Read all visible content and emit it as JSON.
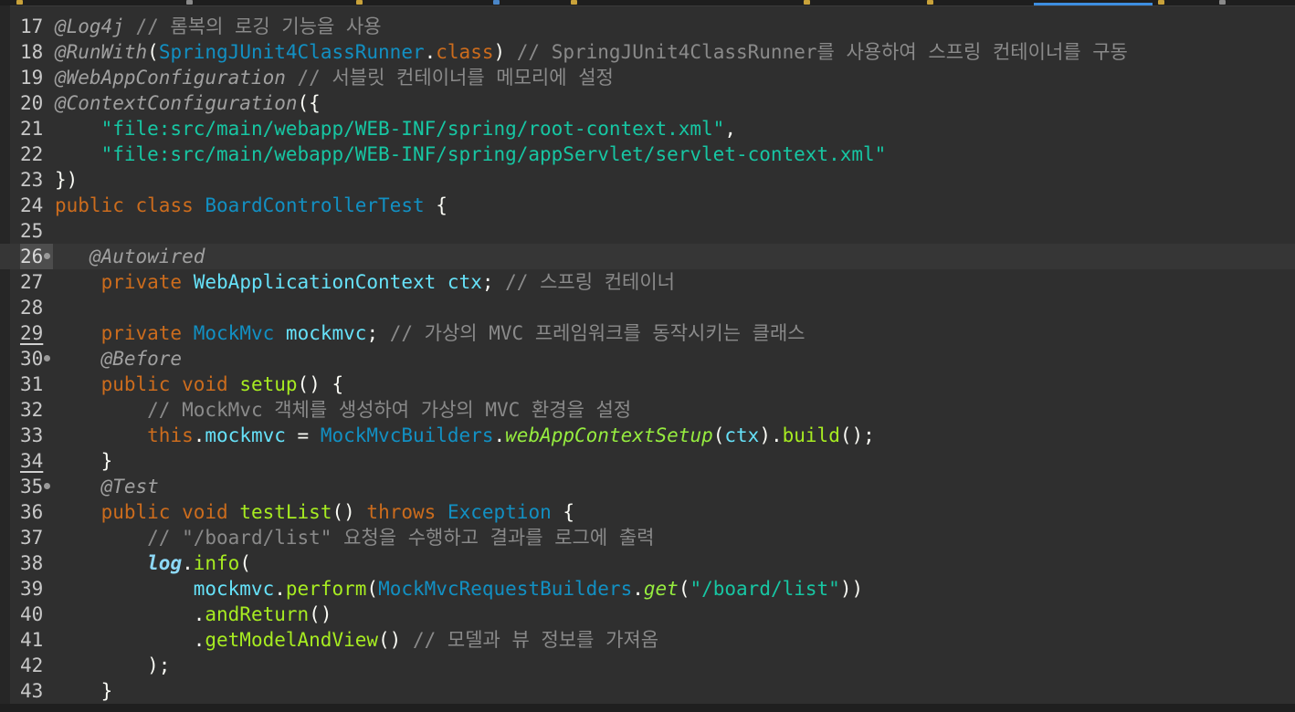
{
  "colors": {
    "background": "#2f2f2f",
    "line_number": "#c8c8c8",
    "annotation": "#a0a0a0",
    "comment": "#8a8a8a",
    "string": "#17c6a3",
    "keyword": "#cc6c1d",
    "class": "#1290c3",
    "field": "#66e1f8",
    "method": "#a7ec21",
    "tab_accent": "#3d8ee0"
  },
  "lines": [
    {
      "n": "17",
      "tokens": [
        {
          "t": "@Log4j",
          "c": "ann"
        },
        {
          "t": " // 롬복의 로깅 기능을 사용",
          "c": "cmt"
        }
      ]
    },
    {
      "n": "18",
      "tokens": [
        {
          "t": "@RunWith",
          "c": "ann"
        },
        {
          "t": "(",
          "c": "pl"
        },
        {
          "t": "SpringJUnit4ClassRunner",
          "c": "cls"
        },
        {
          "t": ".",
          "c": "pl"
        },
        {
          "t": "class",
          "c": "kw"
        },
        {
          "t": ") ",
          "c": "pl"
        },
        {
          "t": "// SpringJUnit4ClassRunner를 사용하여 스프링 컨테이너를 구동",
          "c": "cmt"
        }
      ]
    },
    {
      "n": "19",
      "tokens": [
        {
          "t": "@WebAppConfiguration",
          "c": "ann"
        },
        {
          "t": " // 서블릿 컨테이너를 메모리에 설정",
          "c": "cmt"
        }
      ]
    },
    {
      "n": "20",
      "tokens": [
        {
          "t": "@ContextConfiguration",
          "c": "ann"
        },
        {
          "t": "({",
          "c": "pl"
        }
      ]
    },
    {
      "n": "21",
      "tokens": [
        {
          "t": "    ",
          "c": "pl"
        },
        {
          "t": "\"file:src/main/webapp/WEB-INF/spring/root-context.xml\"",
          "c": "str"
        },
        {
          "t": ",",
          "c": "pl"
        }
      ]
    },
    {
      "n": "22",
      "tokens": [
        {
          "t": "    ",
          "c": "pl"
        },
        {
          "t": "\"file:src/main/webapp/WEB-INF/spring/appServlet/servlet-context.xml\"",
          "c": "str"
        }
      ]
    },
    {
      "n": "23",
      "tokens": [
        {
          "t": "})",
          "c": "pl"
        }
      ]
    },
    {
      "n": "24",
      "tokens": [
        {
          "t": "public",
          "c": "kw"
        },
        {
          "t": " ",
          "c": "pl"
        },
        {
          "t": "class",
          "c": "kw"
        },
        {
          "t": " ",
          "c": "pl"
        },
        {
          "t": "BoardControllerTest",
          "c": "cls"
        },
        {
          "t": " {",
          "c": "pl"
        }
      ]
    },
    {
      "n": "25",
      "tokens": []
    },
    {
      "n": "26",
      "fold": true,
      "current": true,
      "tokens": [
        {
          "t": "   ",
          "c": "pl"
        },
        {
          "t": "@Autowired",
          "c": "ann"
        }
      ]
    },
    {
      "n": "27",
      "tokens": [
        {
          "t": "    ",
          "c": "pl"
        },
        {
          "t": "private",
          "c": "kw"
        },
        {
          "t": " ",
          "c": "pl"
        },
        {
          "t": "WebApplicationContext",
          "c": "fld"
        },
        {
          "t": " ",
          "c": "pl"
        },
        {
          "t": "ctx",
          "c": "fld"
        },
        {
          "t": "; ",
          "c": "pl"
        },
        {
          "t": "// 스프링 컨테이너",
          "c": "cmt"
        }
      ]
    },
    {
      "n": "28",
      "tokens": []
    },
    {
      "n": "29",
      "marked": true,
      "tokens": [
        {
          "t": "    ",
          "c": "pl"
        },
        {
          "t": "private",
          "c": "kw"
        },
        {
          "t": " ",
          "c": "pl"
        },
        {
          "t": "MockMvc",
          "c": "cls"
        },
        {
          "t": " ",
          "c": "pl"
        },
        {
          "t": "mockmvc",
          "c": "fld"
        },
        {
          "t": "; ",
          "c": "pl"
        },
        {
          "t": "// 가상의 MVC 프레임워크를 동작시키는 클래스",
          "c": "cmt"
        }
      ]
    },
    {
      "n": "30",
      "fold": true,
      "tokens": [
        {
          "t": "    ",
          "c": "pl"
        },
        {
          "t": "@Before",
          "c": "ann"
        }
      ]
    },
    {
      "n": "31",
      "tokens": [
        {
          "t": "    ",
          "c": "pl"
        },
        {
          "t": "public",
          "c": "kw"
        },
        {
          "t": " ",
          "c": "pl"
        },
        {
          "t": "void",
          "c": "kw"
        },
        {
          "t": " ",
          "c": "pl"
        },
        {
          "t": "setup",
          "c": "mth"
        },
        {
          "t": "() {",
          "c": "pl"
        }
      ]
    },
    {
      "n": "32",
      "tokens": [
        {
          "t": "        ",
          "c": "pl"
        },
        {
          "t": "// MockMvc 객체를 생성하여 가상의 MVC 환경을 설정",
          "c": "cmt"
        }
      ]
    },
    {
      "n": "33",
      "tokens": [
        {
          "t": "        ",
          "c": "pl"
        },
        {
          "t": "this",
          "c": "kw"
        },
        {
          "t": ".",
          "c": "pl"
        },
        {
          "t": "mockmvc",
          "c": "fld"
        },
        {
          "t": " = ",
          "c": "pl"
        },
        {
          "t": "MockMvcBuilders",
          "c": "cls"
        },
        {
          "t": ".",
          "c": "pl"
        },
        {
          "t": "webAppContextSetup",
          "c": "smt"
        },
        {
          "t": "(",
          "c": "pl"
        },
        {
          "t": "ctx",
          "c": "fld"
        },
        {
          "t": ").",
          "c": "pl"
        },
        {
          "t": "build",
          "c": "mth"
        },
        {
          "t": "();",
          "c": "pl"
        }
      ]
    },
    {
      "n": "34",
      "marked": true,
      "tokens": [
        {
          "t": "    }",
          "c": "pl"
        }
      ]
    },
    {
      "n": "35",
      "fold": true,
      "tokens": [
        {
          "t": "    ",
          "c": "pl"
        },
        {
          "t": "@Test",
          "c": "ann"
        }
      ]
    },
    {
      "n": "36",
      "tokens": [
        {
          "t": "    ",
          "c": "pl"
        },
        {
          "t": "public",
          "c": "kw"
        },
        {
          "t": " ",
          "c": "pl"
        },
        {
          "t": "void",
          "c": "kw"
        },
        {
          "t": " ",
          "c": "pl"
        },
        {
          "t": "testList",
          "c": "mth"
        },
        {
          "t": "() ",
          "c": "pl"
        },
        {
          "t": "throws",
          "c": "kw"
        },
        {
          "t": " ",
          "c": "pl"
        },
        {
          "t": "Exception",
          "c": "cls"
        },
        {
          "t": " {",
          "c": "pl"
        }
      ]
    },
    {
      "n": "37",
      "tokens": [
        {
          "t": "        ",
          "c": "pl"
        },
        {
          "t": "// \"/board/list\" 요청을 수행하고 결과를 로그에 출력",
          "c": "cmt"
        }
      ]
    },
    {
      "n": "38",
      "tokens": [
        {
          "t": "        ",
          "c": "pl"
        },
        {
          "t": "log",
          "c": "sfld"
        },
        {
          "t": ".",
          "c": "pl"
        },
        {
          "t": "info",
          "c": "mth"
        },
        {
          "t": "(",
          "c": "pl"
        }
      ]
    },
    {
      "n": "39",
      "tokens": [
        {
          "t": "            ",
          "c": "pl"
        },
        {
          "t": "mockmvc",
          "c": "fld"
        },
        {
          "t": ".",
          "c": "pl"
        },
        {
          "t": "perform",
          "c": "mth"
        },
        {
          "t": "(",
          "c": "pl"
        },
        {
          "t": "MockMvcRequestBuilders",
          "c": "cls"
        },
        {
          "t": ".",
          "c": "pl"
        },
        {
          "t": "get",
          "c": "smt"
        },
        {
          "t": "(",
          "c": "pl"
        },
        {
          "t": "\"/board/list\"",
          "c": "str"
        },
        {
          "t": "))",
          "c": "pl"
        }
      ]
    },
    {
      "n": "40",
      "tokens": [
        {
          "t": "            .",
          "c": "pl"
        },
        {
          "t": "andReturn",
          "c": "mth"
        },
        {
          "t": "()",
          "c": "pl"
        }
      ]
    },
    {
      "n": "41",
      "tokens": [
        {
          "t": "            .",
          "c": "pl"
        },
        {
          "t": "getModelAndView",
          "c": "mth"
        },
        {
          "t": "() ",
          "c": "pl"
        },
        {
          "t": "// 모델과 뷰 정보를 가져옴",
          "c": "cmt"
        }
      ]
    },
    {
      "n": "42",
      "tokens": [
        {
          "t": "        );",
          "c": "pl"
        }
      ]
    },
    {
      "n": "43",
      "tokens": [
        {
          "t": "    }",
          "c": "pl"
        }
      ]
    }
  ]
}
